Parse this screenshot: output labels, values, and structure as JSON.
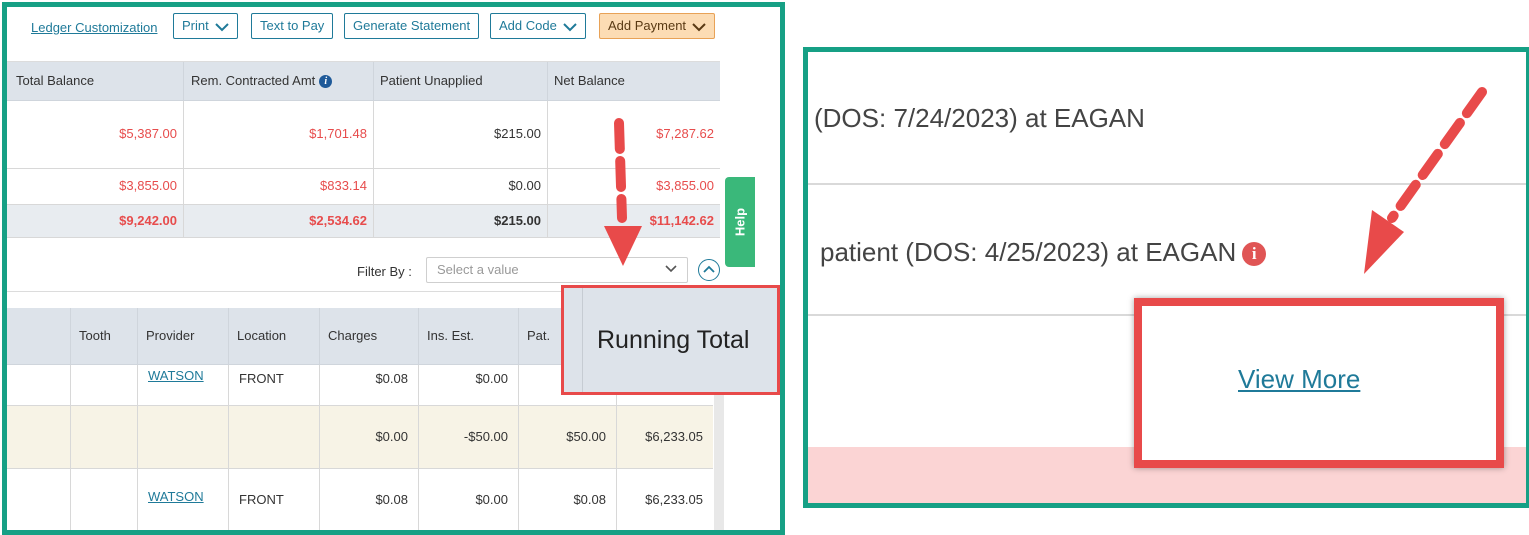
{
  "toolbar": {
    "ledger_customization": "Ledger Customization",
    "print": "Print",
    "text_to_pay": "Text to Pay",
    "generate_statement": "Generate Statement",
    "add_code": "Add Code",
    "add_payment": "Add Payment"
  },
  "summary": {
    "headers": [
      "Total Balance",
      "Rem. Contracted Amt",
      "Patient Unapplied",
      "Net Balance"
    ],
    "rows": [
      [
        "$5,387.00",
        "$1,701.48",
        "$215.00",
        "$7,287.62"
      ],
      [
        "$3,855.00",
        "$833.14",
        "$0.00",
        "$3,855.00"
      ]
    ],
    "totals": [
      "$9,242.00",
      "$2,534.62",
      "$215.00",
      "$11,142.62"
    ]
  },
  "filter": {
    "label": "Filter By :",
    "placeholder": "Select a value"
  },
  "help_tab": "Help",
  "ledger_table": {
    "headers": [
      "Tooth",
      "Provider",
      "Location",
      "Charges",
      "Ins. Est.",
      "Pat."
    ],
    "rows": [
      {
        "provider": "WATSON",
        "location": "FRONT",
        "charges": "$0.08",
        "ins_est": "$0.00",
        "pat": "",
        "running": ""
      },
      {
        "provider": "",
        "location": "",
        "charges": "$0.00",
        "ins_est": "-$50.00",
        "pat": "$50.00",
        "running": "$6,233.05"
      },
      {
        "provider": "WATSON",
        "location": "FRONT",
        "charges": "$0.08",
        "ins_est": "$0.00",
        "pat": "$0.08",
        "running": "$6,233.05"
      }
    ]
  },
  "callout_running_total": "Running Total",
  "zoom": {
    "line1": "(DOS: 7/24/2023) at EAGAN",
    "line2": "patient (DOS: 4/25/2023) at EAGAN",
    "view_more": "View More"
  },
  "colors": {
    "panel_border": "#16a085",
    "callout_red": "#e84a4a",
    "balance_red": "#e74c4c",
    "link_teal": "#1f7a99",
    "help_green": "#3ab87a"
  }
}
